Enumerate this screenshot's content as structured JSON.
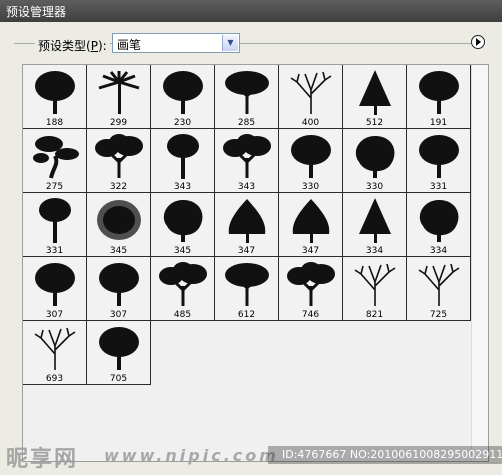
{
  "window": {
    "title": "预设管理器"
  },
  "preset_type": {
    "label": "预设类型(P):",
    "label_main": "预设类型(",
    "label_key": "P",
    "label_end": "):",
    "value": "画笔"
  },
  "brushes": [
    {
      "size": "188"
    },
    {
      "size": "299"
    },
    {
      "size": "230"
    },
    {
      "size": "285"
    },
    {
      "size": "400"
    },
    {
      "size": "512"
    },
    {
      "size": "191"
    },
    {
      "size": "275"
    },
    {
      "size": "322"
    },
    {
      "size": "343"
    },
    {
      "size": "343"
    },
    {
      "size": "330"
    },
    {
      "size": "330"
    },
    {
      "size": "331"
    },
    {
      "size": "331"
    },
    {
      "size": "345"
    },
    {
      "size": "345"
    },
    {
      "size": "347"
    },
    {
      "size": "347"
    },
    {
      "size": "334"
    },
    {
      "size": "334"
    },
    {
      "size": "307"
    },
    {
      "size": "307"
    },
    {
      "size": "485"
    },
    {
      "size": "612"
    },
    {
      "size": "746"
    },
    {
      "size": "821"
    },
    {
      "size": "725"
    },
    {
      "size": "693"
    },
    {
      "size": "705"
    }
  ],
  "watermark": {
    "logo": "昵享网",
    "url": "www.nipic.com",
    "id_text": "ID:4767667 NO:20100610082950029117"
  }
}
